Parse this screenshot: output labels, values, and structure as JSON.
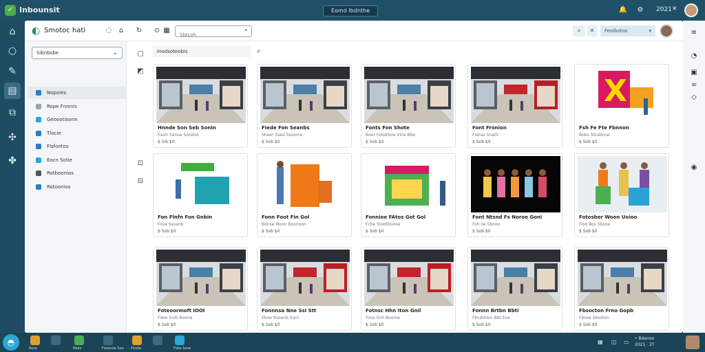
{
  "topbar": {
    "app_title": "Inbounsit",
    "center_label": "Eomd Ibdnthe",
    "time": "2021",
    "close_glyph": "✕"
  },
  "window": {
    "title": "Smotoc hati",
    "search": {
      "value": "",
      "placeholder": "Sbtcoh"
    },
    "select_label": "Feoibotos",
    "toolbar_btn_1": "»",
    "toolbar_btn_2": "✕"
  },
  "sidebar": {
    "dropdown": "Sibnbsbe",
    "items": [
      {
        "label": "Nopoies",
        "color": "#2b7fc0"
      },
      {
        "label": "Rope Fnnnrs",
        "color": "#9aa5ad"
      },
      {
        "label": "Geoootioonn",
        "color": "#2aa7d6"
      },
      {
        "label": "Tlocie",
        "color": "#2b7fc0"
      },
      {
        "label": "Flsfontos",
        "color": "#2b7fc0"
      },
      {
        "label": "Eocn Sotie",
        "color": "#2aa7d6"
      },
      {
        "label": "Rotboonios",
        "color": "#555555"
      },
      {
        "label": "Rotoonios",
        "color": "#2b7fc0"
      }
    ]
  },
  "content": {
    "breadcrumb": "Inodsoteobis",
    "cards": [
      {
        "title": "Hnnde Son Seb Sonin",
        "sub": "Eauh Sanoe Soodoe",
        "meta": "$ Sib $0",
        "scene": "mall"
      },
      {
        "title": "Fiede Fon Seanbs",
        "sub": "Sheer Ssee Ssoome",
        "meta": "$ Sob $0",
        "scene": "mall"
      },
      {
        "title": "Fonts Fon Shote",
        "sub": "Boor Fotekboe Vlne Bbe",
        "meta": "$ Sob $0",
        "scene": "mall"
      },
      {
        "title": "Font Fronion",
        "sub": "Flehar Snatir",
        "meta": "$ Sob $0",
        "scene": "mall-red"
      },
      {
        "title": "Fsh Fe Fte Fbnnon",
        "sub": "Bobs Stnsbone",
        "meta": "$ Sob $0",
        "scene": "x-sign"
      },
      {
        "title": "Fon Flnfn Fon Gnbin",
        "sub": "Fosa Ssoenb",
        "meta": "$ Sob $0",
        "scene": "kiosk-green"
      },
      {
        "title": "Fonn Foot Fin Gol",
        "sub": "Bonse Moon Boonoon",
        "meta": "$ Sob $0",
        "scene": "kiosk-orange"
      },
      {
        "title": "Fonnioe FAtos Got Gol",
        "sub": "Fcbe Stedtbiiooe",
        "meta": "$ Sob $0",
        "scene": "kiosk-stall"
      },
      {
        "title": "Font Ntsnd Fs Noroe Goni",
        "sub": "Foh Iie Sbnoo",
        "meta": "$ Sob $0",
        "scene": "dark-figures"
      },
      {
        "title": "Fotosbor Woon Uoioo",
        "sub": "Fiod Bos Sbooe",
        "meta": "$ Sob $0",
        "scene": "figures-light"
      },
      {
        "title": "Foteoormoft IOOI",
        "sub": "Fdoe Snib Boone",
        "meta": "$ Sob $0",
        "scene": "mall"
      },
      {
        "title": "Fonnnsa Nne Ssi Stt",
        "sub": "Eboe Ssoenb Soro",
        "meta": "$ Sob $0",
        "scene": "mall-red"
      },
      {
        "title": "Fotnsc Hhn Iton Gnil",
        "sub": "Fosa Snh Boome",
        "meta": "$ Sob $0",
        "scene": "mall-red"
      },
      {
        "title": "Fonnn Brtbn Bbti",
        "sub": "Fbcdotion Bbt Eoe",
        "meta": "$ Sob $0",
        "scene": "mall"
      },
      {
        "title": "Fbsocton Frno Gopb",
        "sub": "Fbsoe Sbiolion",
        "meta": "$ Sob $0",
        "scene": "mall"
      }
    ]
  },
  "taskbar": {
    "items": [
      {
        "label": "Roso",
        "color": "#e0a030"
      },
      {
        "label": "",
        "color": "#3a6a80"
      },
      {
        "label": "Rbes",
        "color": "#4caf50"
      },
      {
        "label": "Fosonde Soo",
        "color": "#3a6a80"
      },
      {
        "label": "Ficebs",
        "color": "#e0a030"
      },
      {
        "label": "",
        "color": "#3a6a80"
      },
      {
        "label": "Fobs Sose",
        "color": "#2aa7d6"
      }
    ],
    "tray_text": "• Bdanoo\n2021 · 2T"
  }
}
